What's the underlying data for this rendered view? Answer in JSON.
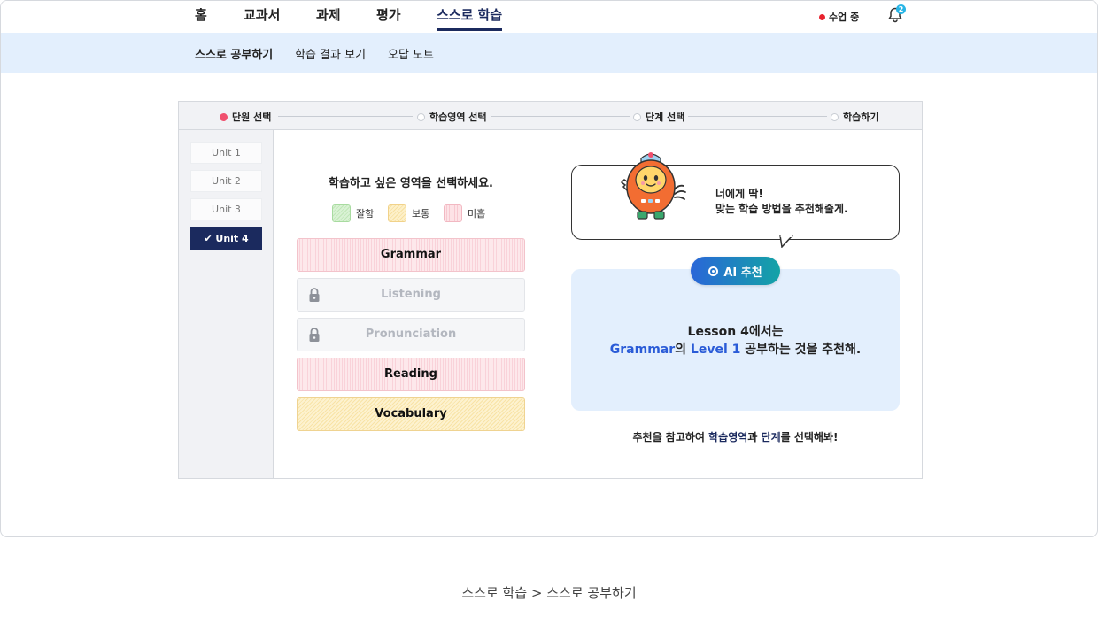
{
  "nav": {
    "items": [
      "홈",
      "교과서",
      "과제",
      "평가",
      "스스로 학습"
    ],
    "active_index": 4,
    "live_status": "수업 중",
    "notification_count": "2"
  },
  "subnav": {
    "items": [
      "스스로 공부하기",
      "학습 결과 보기",
      "오답 노트"
    ],
    "active_index": 0
  },
  "steps": [
    "단원 선택",
    "학습영역 선택",
    "단계 선택",
    "학습하기"
  ],
  "units": [
    "Unit 1",
    "Unit 2",
    "Unit 3",
    "Unit 4"
  ],
  "selected_unit_check": "✔",
  "area_panel": {
    "title": "학습하고 싶은 영역을 선택하세요.",
    "legend": [
      "잘함",
      "보통",
      "미흡"
    ],
    "areas": [
      {
        "label": "Grammar",
        "status": "미흡"
      },
      {
        "label": "Listening",
        "status": "locked"
      },
      {
        "label": "Pronunciation",
        "status": "locked"
      },
      {
        "label": "Reading",
        "status": "미흡"
      },
      {
        "label": "Vocabulary",
        "status": "보통"
      }
    ]
  },
  "recommend": {
    "bubble_line1": "너에게 딱!",
    "bubble_line2": "맞는 학습 방법을 추천해줄게.",
    "pill": "AI 추천",
    "line1": "Lesson 4에서는",
    "area": "Grammar",
    "particle": "의",
    "level": "Level 1",
    "tail": "공부하는 것을 추천해.",
    "hint_pre": "추천을 참고하여 ",
    "hint_area": "학습영역",
    "hint_mid": "과 ",
    "hint_step": "단계",
    "hint_post": "를 선택해봐!"
  },
  "caption": "스스로 학습 > 스스로 공부하기",
  "colors": {
    "navy": "#1b2a5e",
    "accent_blue": "#2a5bd7",
    "subnav_bg": "#e3effd",
    "live_red": "#e8222e",
    "step_active": "#f0506e"
  }
}
